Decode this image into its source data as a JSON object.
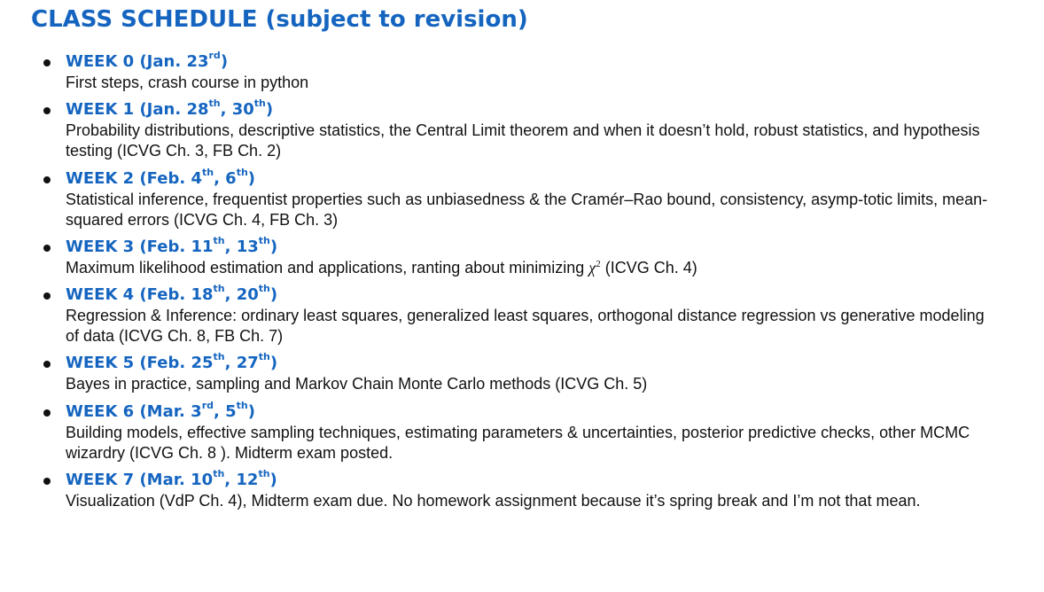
{
  "document": {
    "title": "CLASS SCHEDULE (subject to revision)"
  },
  "weeks": [
    {
      "label": "WEEK 0 (Jan. 23",
      "dates": [
        {
          "num": "",
          "suffix": "rd"
        }
      ],
      "tail": ")",
      "description": "First steps, crash course in python"
    },
    {
      "label": "WEEK 1 (Jan. 28",
      "suffix1": "th",
      "mid": ", 30",
      "suffix2": "th",
      "tail": ")",
      "description": "Probability distributions, descriptive statistics, the Central Limit theorem and when it doesn’t hold, robust statistics, and hypothesis testing (ICVG Ch. 3, FB Ch. 2)"
    },
    {
      "label": "WEEK 2 (Feb. 4",
      "suffix1": "th",
      "mid": ", 6",
      "suffix2": "th",
      "tail": ")",
      "description": "Statistical inference, frequentist properties such as unbiasedness & the Cramér–Rao bound, consistency, asymp-totic limits, mean-squared errors (ICVG Ch. 4, FB Ch. 3)"
    },
    {
      "label": "WEEK 3 (Feb. 11",
      "suffix1": "th",
      "mid": ", 13",
      "suffix2": "th",
      "tail": ")",
      "description_before": "Maximum likelihood estimation and applications, ranting about minimizing ",
      "chi_symbol": "χ",
      "chi_power": "2",
      "description_after": " (ICVG Ch. 4)"
    },
    {
      "label": "WEEK 4 (Feb. 18",
      "suffix1": "th",
      "mid": ", 20",
      "suffix2": "th",
      "tail": ")",
      "description": "Regression & Inference: ordinary least squares, generalized least squares, orthogonal distance regression vs generative modeling of data (ICVG Ch. 8, FB Ch. 7)"
    },
    {
      "label": "WEEK 5 (Feb. 25",
      "suffix1": "th",
      "mid": ", 27",
      "suffix2": "th",
      "tail": ")",
      "description": "Bayes in practice, sampling and Markov Chain Monte Carlo methods (ICVG Ch. 5)"
    },
    {
      "label": "WEEK 6 (Mar. 3",
      "suffix1": "rd",
      "mid": ", 5",
      "suffix2": "th",
      "tail": ")",
      "description": "Building models, effective sampling techniques, estimating parameters & uncertainties, posterior predictive checks, other MCMC wizardry (ICVG Ch. 8 ).  Midterm exam posted."
    },
    {
      "label": "WEEK 7 (Mar. 10",
      "suffix1": "th",
      "mid": ", 12",
      "suffix2": "th",
      "tail": ")",
      "description": "Visualization (VdP Ch. 4), Midterm exam due.  No homework assignment because it’s spring break and I’m not that mean."
    }
  ],
  "week0_suffix": "rd",
  "colors": {
    "heading": "#1565c0",
    "body_text": "#111111",
    "background": "#ffffff"
  }
}
